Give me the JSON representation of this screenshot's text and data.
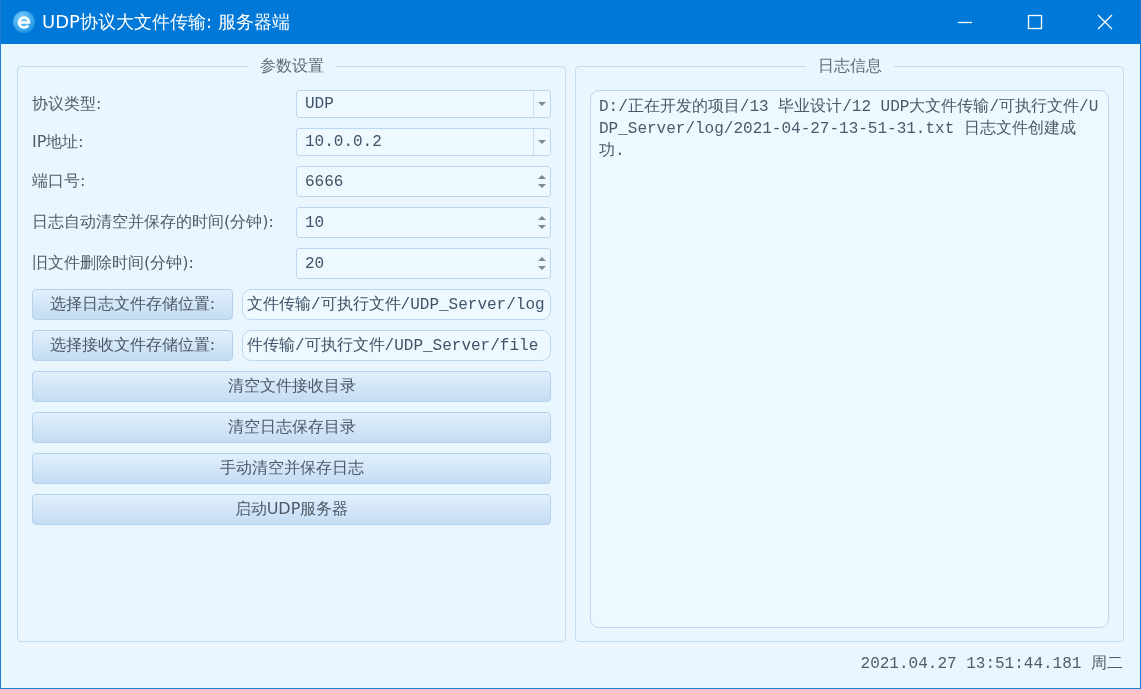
{
  "window": {
    "title": "UDP协议大文件传输: 服务器端"
  },
  "settings": {
    "title": "参数设置",
    "fields": [
      {
        "kind": "combo",
        "label": "协议类型:",
        "value": "UDP"
      },
      {
        "kind": "combo",
        "label": "IP地址:",
        "value": "10.0.0.2"
      },
      {
        "kind": "spin",
        "label": "端口号:",
        "value": "6666"
      },
      {
        "kind": "spin",
        "label": "日志自动清空并保存的时间(分钟):",
        "value": "10"
      },
      {
        "kind": "spin",
        "label": "旧文件删除时间(分钟):",
        "value": "20"
      }
    ],
    "path_pickers": [
      {
        "button": "选择日志文件存储位置:",
        "path": "文件传输/可执行文件/UDP_Server/log"
      },
      {
        "button": "选择接收文件存储位置:",
        "path": "件传输/可执行文件/UDP_Server/file"
      }
    ],
    "actions": [
      "清空文件接收目录",
      "清空日志保存目录",
      "手动清空并保存日志",
      "启动UDP服务器"
    ]
  },
  "log": {
    "title": "日志信息",
    "text": "D:/正在开发的项目/13 毕业设计/12 UDP大文件传输/可执行文件/UDP_Server/log/2021-04-27-13-51-31.txt 日志文件创建成功."
  },
  "status_bar": {
    "datetime": "2021.04.27 13:51:44.181 周二"
  }
}
